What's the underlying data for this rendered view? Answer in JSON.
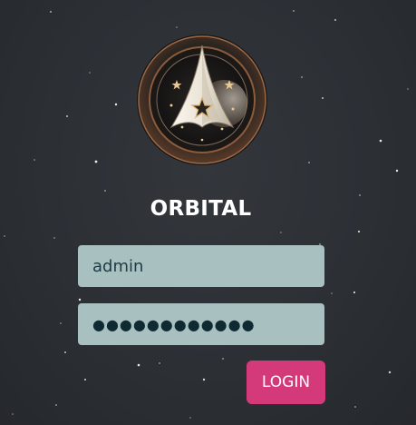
{
  "app": {
    "title": "ORBITAL"
  },
  "form": {
    "username_value": "admin",
    "password_value": "●●●●●●●●●●●●",
    "login_label": "LOGIN"
  },
  "theme": {
    "background": "#2c3035",
    "field_background": "#a8c0bf",
    "button_color": "#d4397a",
    "title_color": "#ffffff"
  },
  "icons": {
    "logo": "orbital-emblem-icon"
  }
}
